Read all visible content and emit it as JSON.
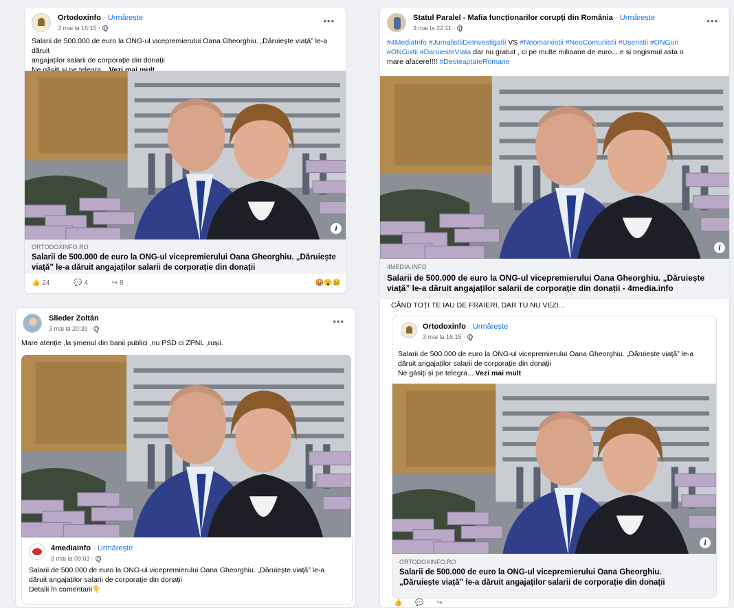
{
  "post_a": {
    "author": "Ortodoxinfo",
    "follow": "Urmărește",
    "time": "3 mai la 16:15",
    "line1": "Salarii de 500.000 de euro la ONG-ul vicepremierului Oana Gheorghiu. „Dăruiește viață” le-a dăruit",
    "line2": "angajaților salarii de corporație din donații",
    "line3": "Ne găsiți și pe telegra...",
    "see_more": "Vezi mai mult",
    "domain": "ORTODOXINFO.RO",
    "link_title": "Salarii de 500.000 de euro la ONG-ul vicepremierului Oana Gheorghiu. „Dăruiește viață” le-a dăruit angajaților salarii de corporație din donații",
    "likes": "24",
    "comments": "4",
    "shares": "8"
  },
  "post_b": {
    "author": "Statul Paralel - Mafia funcționarilor corupți din România",
    "follow": "Urmărește",
    "time": "3 mai la 22:11",
    "tags1": "#4MediaInfo #JurnalistiiDeInvestigatii",
    "vs": " VS ",
    "tags2": "#Neomarxistii #NeoComunistii #Useristii #ONGuri",
    "tags3": "#ONGistii #DaruiesteViata",
    "text_mid": " dar nu gratuit , ci pe multe milioane de euro... e si ongismul asta o",
    "text_end": "mare afacere!!!! ",
    "tag_end": "#DesteaptateRomane",
    "domain": "4MEDIA.INFO",
    "link_title": "Salarii de 500.000 de euro la ONG-ul vicepremierului Oana Gheorghiu. „Dăruiește viață” le-a dăruit angajaților salarii de corporație din donații - 4media.info"
  },
  "post_c": {
    "author": "Slieder Zoltán",
    "time": "3 mai la 20:39",
    "text": "Mare atenție ,la șmenul din banii publici ,nu PSD ci ZPNL ,rușii.",
    "shared_author": "4mediainfo",
    "follow": "Urmărește",
    "shared_time": "3 mai la 09:03",
    "shared_line1": "Salarii de 500.000 de euro la ONG-ul vicepremierului Oana Gheorghiu. „Dăruiește viață” le-a",
    "shared_line2": "dăruit angajaților salarii de corporație din donații",
    "shared_line3": "Detalii în comentarii👇"
  },
  "post_d": {
    "caption": "CÂND TOȚI TE IAU DE FRAIERI, DAR TU NU VEZI...",
    "shared_author": "Ortodoxinfo",
    "follow": "Urmărește",
    "shared_time": "3 mai la 16:15",
    "line1": "Salarii de 500.000 de euro la ONG-ul vicepremierului Oana Gheorghiu. „Dăruiește viață” le-a",
    "line2": "dăruit angajaților salarii de corporație din donații",
    "line3": "Ne găsiți și pe telegra...",
    "see_more": "Vezi mai mult",
    "domain": "ORTODOXINFO.RO",
    "link_title1": "Salarii de 500.000 de euro la ONG-ul vicepremierului Oana Gheorghiu.",
    "link_title2": "„Dăruiește viață” le-a dăruit angajaților salarii de corporație din donații"
  },
  "icons": {
    "more": "more-options-icon",
    "globe": "globe-icon",
    "like": "like-icon",
    "comment": "comment-icon",
    "share": "share-icon",
    "info": "info-icon"
  },
  "colors": {
    "link_blue": "#1b74e4",
    "meta_gray": "#65676b",
    "bar_bg": "#f0f2f5"
  }
}
